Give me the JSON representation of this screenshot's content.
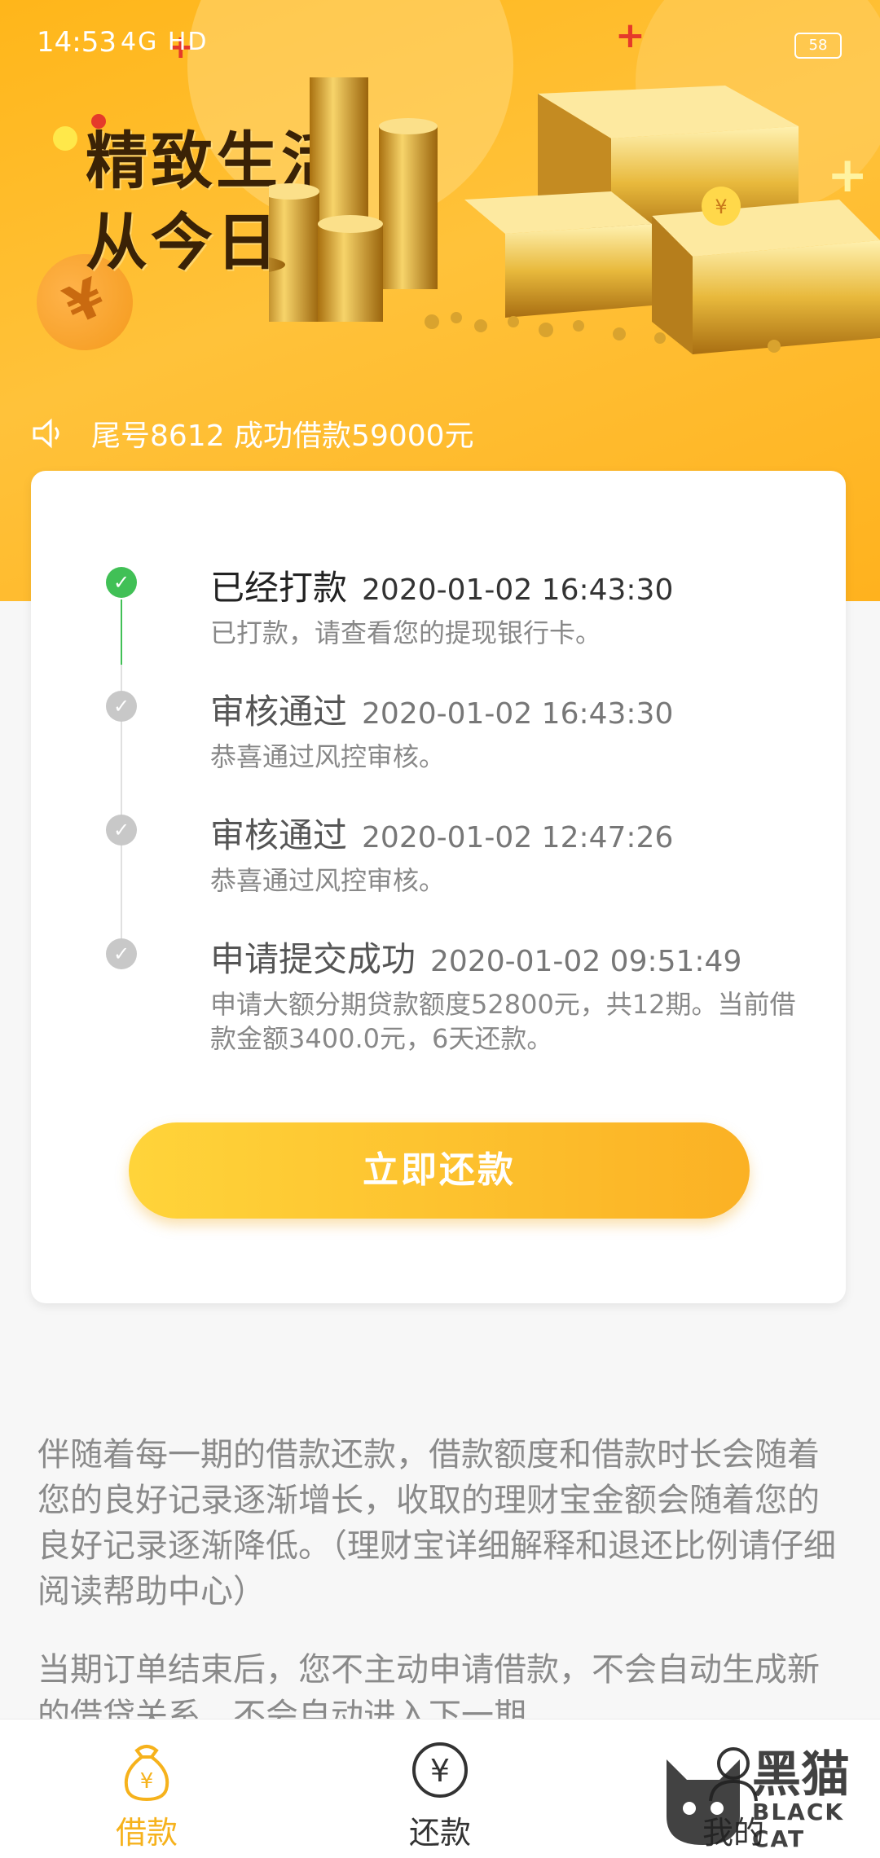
{
  "status_bar": {
    "time": "14:53",
    "network": "4G HD",
    "battery": "58"
  },
  "banner": {
    "slogan_line1": "精致生活",
    "slogan_line2": "从今日开始",
    "coin_symbol": "¥",
    "notice": "尾号8612 成功借款59000元"
  },
  "timeline": [
    {
      "title": "已经打款",
      "time": "2020-01-02 16:43:30",
      "desc": "已打款，请查看您的提现银行卡。",
      "status": "done"
    },
    {
      "title": "审核通过",
      "time": "2020-01-02 16:43:30",
      "desc": "恭喜通过风控审核。",
      "status": "past"
    },
    {
      "title": "审核通过",
      "time": "2020-01-02 12:47:26",
      "desc": "恭喜通过风控审核。",
      "status": "past"
    },
    {
      "title": "申请提交成功",
      "time": "2020-01-02 09:51:49",
      "desc": "申请大额分期贷款额度52800元，共12期。当前借款金额3400.0元，6天还款。",
      "status": "past"
    }
  ],
  "repay_button": "立即还款",
  "info": {
    "paragraph1": "伴随着每一期的借款还款，借款额度和借款时长会随着您的良好记录逐渐增长，收取的理财宝金额会随着您的良好记录逐渐降低。（理财宝详细解释和退还比例请仔细阅读帮助中心）",
    "paragraph2": "当期订单结束后，您不主动申请借款，不会自动生成新的借贷关系，不会自动进入下一期"
  },
  "bottom_nav": {
    "items": [
      {
        "label": "借款",
        "icon": "money-bag-icon"
      },
      {
        "label": "还款",
        "icon": "yen-circle-icon"
      },
      {
        "label": "我的",
        "icon": "user-icon"
      }
    ]
  },
  "watermark": {
    "text": "黑猫",
    "sub": "BLACK CAT"
  },
  "colors": {
    "accent": "#f6b21c",
    "success": "#41c056"
  }
}
